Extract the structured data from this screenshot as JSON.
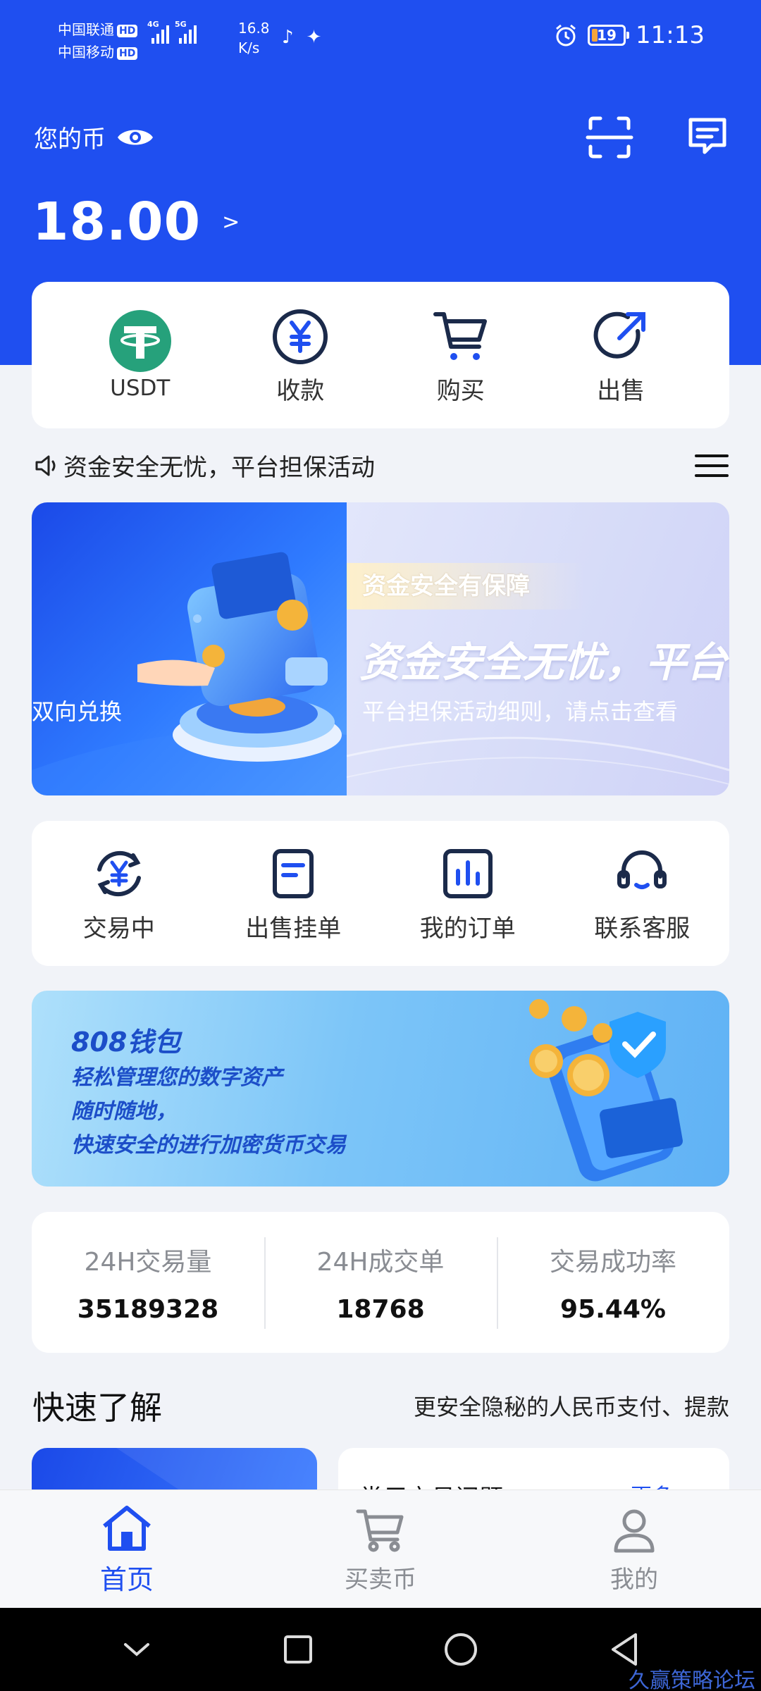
{
  "status_bar": {
    "carrier1": "中国联通",
    "carrier2": "中国移动",
    "hd": "HD",
    "net1": "4G",
    "net2": "5G",
    "speed_value": "16.8",
    "speed_unit": "K/s",
    "battery": "19",
    "time": "11:13"
  },
  "header": {
    "balance_label": "您的币",
    "balance_value": "18.00",
    "balance_chevron": ">"
  },
  "quick_actions": [
    {
      "label": "USDT"
    },
    {
      "label": "收款"
    },
    {
      "label": "购买"
    },
    {
      "label": "出售"
    }
  ],
  "notice": {
    "text": "资金安全无忧，平台担保活动"
  },
  "banner": {
    "left_text": "双向兑换",
    "tag": "资金安全有保障",
    "title": "资金安全无忧，平台担",
    "subtitle": "平台担保活动细则，请点击查看"
  },
  "services": [
    {
      "label": "交易中"
    },
    {
      "label": "出售挂单"
    },
    {
      "label": "我的订单"
    },
    {
      "label": "联系客服"
    }
  ],
  "promo": {
    "title": "808钱包",
    "lines": "轻松管理您的数字资产\n随时随地，\n快速安全的进行加密货币交易"
  },
  "stats": [
    {
      "label": "24H交易量",
      "value": "35189328"
    },
    {
      "label": "24H成交单",
      "value": "18768"
    },
    {
      "label": "交易成功率",
      "value": "95.44%"
    }
  ],
  "quick_understand": {
    "title": "快速了解",
    "subtitle": "更安全隐秘的人民币支付、提款",
    "card2_title": "常用交易问题",
    "card2_more": "更多"
  },
  "tabbar": [
    {
      "label": "首页",
      "active": true
    },
    {
      "label": "买卖币",
      "active": false
    },
    {
      "label": "我的",
      "active": false
    }
  ],
  "watermark": "久赢策略论坛",
  "colors": {
    "primary": "#1f4ff0",
    "usdt_green": "#26a17b",
    "background": "#f1f3f8"
  }
}
